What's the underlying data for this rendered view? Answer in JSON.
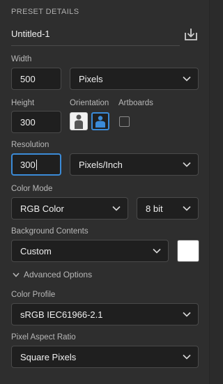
{
  "header": {
    "title": "PRESET DETAILS"
  },
  "preset": {
    "name": "Untitled-1",
    "save_icon": "save-preset-icon"
  },
  "width": {
    "label": "Width",
    "value": "500",
    "unit": "Pixels"
  },
  "height": {
    "label": "Height",
    "value": "300"
  },
  "orientation": {
    "label": "Orientation",
    "selected": "landscape"
  },
  "artboards": {
    "label": "Artboards",
    "checked": false
  },
  "resolution": {
    "label": "Resolution",
    "value": "300",
    "unit": "Pixels/Inch"
  },
  "color_mode": {
    "label": "Color Mode",
    "mode": "RGB Color",
    "depth": "8 bit"
  },
  "background": {
    "label": "Background Contents",
    "value": "Custom",
    "swatch_color": "#ffffff"
  },
  "advanced": {
    "label": "Advanced Options"
  },
  "color_profile": {
    "label": "Color Profile",
    "value": "sRGB IEC61966-2.1"
  },
  "pixel_aspect": {
    "label": "Pixel Aspect Ratio",
    "value": "Square Pixels"
  },
  "colors": {
    "accent": "#3b8bd8",
    "panel": "#2e2e2e",
    "field": "#1f1f1f"
  }
}
